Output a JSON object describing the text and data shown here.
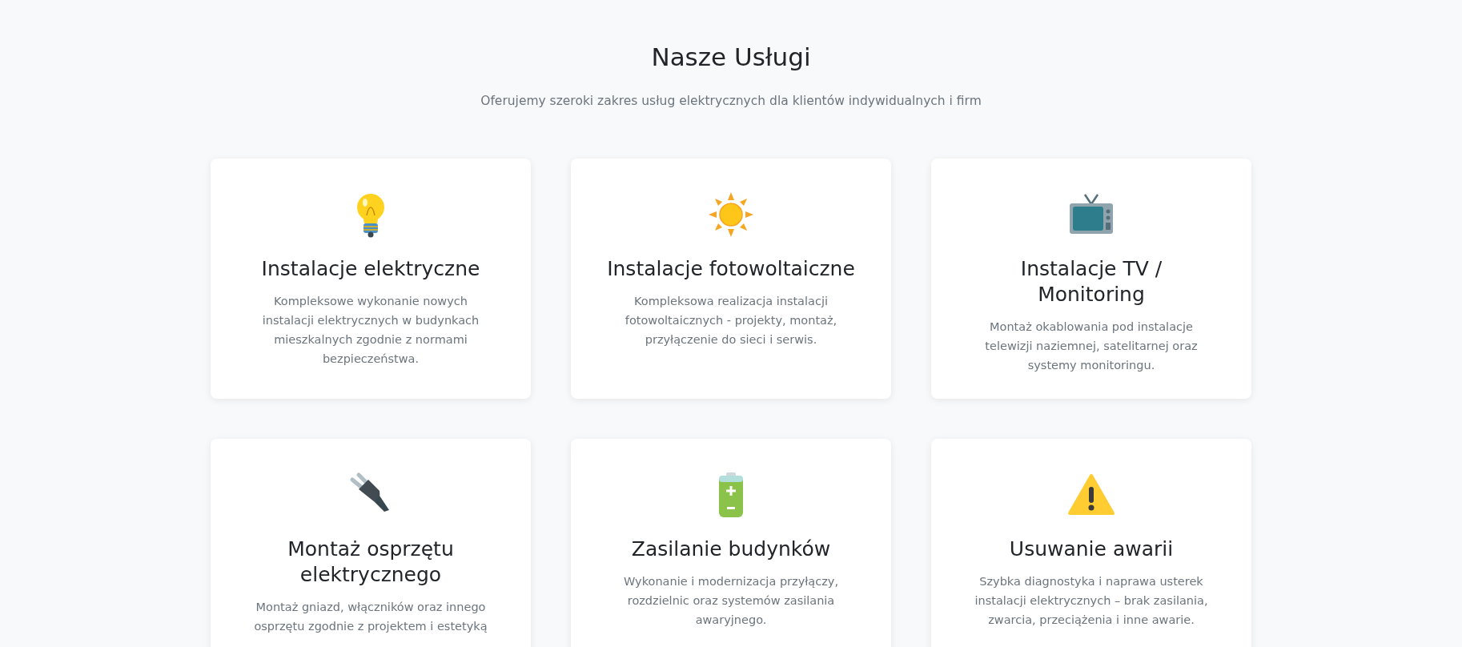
{
  "heading": "Nasze Usługi",
  "subtitle": "Oferujemy szeroki zakres usług elektrycznych dla klientów indywidualnych i firm",
  "services": [
    {
      "title": "Instalacje elektryczne",
      "description": "Kompleksowe wykonanie nowych instalacji elektrycznych w budynkach mieszkalnych zgodnie z normami bezpieczeństwa."
    },
    {
      "title": "Instalacje fotowoltaiczne",
      "description": "Kompleksowa realizacja instalacji fotowoltaicznych - projekty, montaż, przyłączenie do sieci i serwis."
    },
    {
      "title": "Instalacje TV / Monitoring",
      "description": "Montaż okablowania pod instalacje telewizji naziemnej, satelitarnej oraz systemy monitoringu."
    },
    {
      "title": "Montaż osprzętu elektrycznego",
      "description": "Montaż gniazd, włączników oraz innego osprzętu zgodnie z projektem i estetyką"
    },
    {
      "title": "Zasilanie budynków",
      "description": "Wykonanie i modernizacja przyłączy, rozdzielnic oraz systemów zasilania awaryjnego."
    },
    {
      "title": "Usuwanie awarii",
      "description": "Szybka diagnostyka i naprawa usterek instalacji elektrycznych – brak zasilania, zwarcia, przeciążenia i inne awarie."
    }
  ]
}
